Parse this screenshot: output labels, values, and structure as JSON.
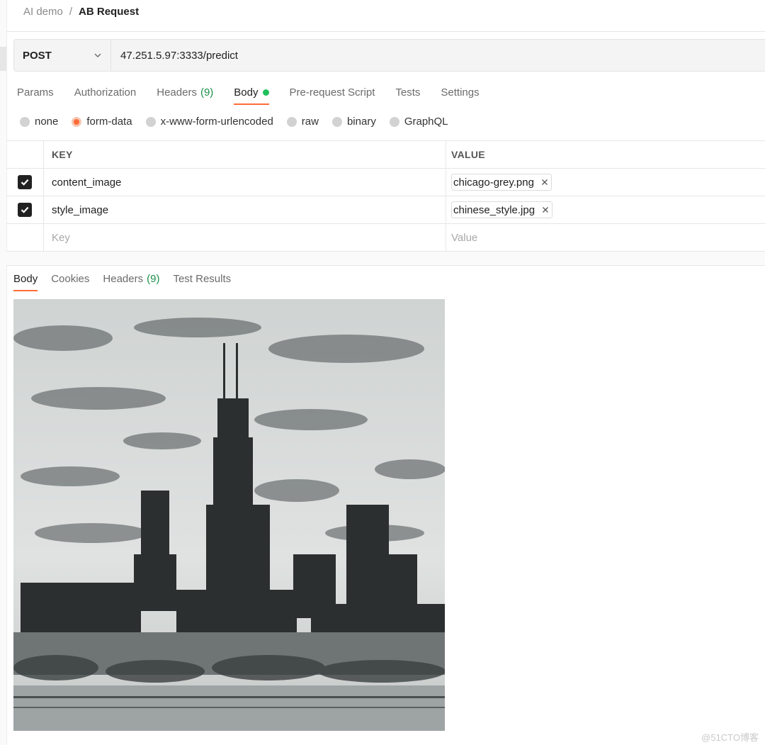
{
  "breadcrumb": {
    "parent": "AI demo",
    "separator": "/",
    "current": "AB Request"
  },
  "request": {
    "method": "POST",
    "url": "47.251.5.97:3333/predict"
  },
  "request_tabs": [
    {
      "label": "Params"
    },
    {
      "label": "Authorization"
    },
    {
      "label": "Headers",
      "count": "(9)"
    },
    {
      "label": "Body",
      "active": true
    },
    {
      "label": "Pre-request Script"
    },
    {
      "label": "Tests"
    },
    {
      "label": "Settings"
    }
  ],
  "body_types": [
    {
      "label": "none"
    },
    {
      "label": "form-data",
      "selected": true
    },
    {
      "label": "x-www-form-urlencoded"
    },
    {
      "label": "raw"
    },
    {
      "label": "binary"
    },
    {
      "label": "GraphQL"
    }
  ],
  "form_table": {
    "headers": {
      "key": "KEY",
      "value": "VALUE"
    },
    "rows": [
      {
        "checked": true,
        "key": "content_image",
        "value": "chicago-grey.png"
      },
      {
        "checked": true,
        "key": "style_image",
        "value": "chinese_style.jpg"
      }
    ],
    "placeholder": {
      "key": "Key",
      "value": "Value"
    }
  },
  "response_tabs": [
    {
      "label": "Body",
      "active": true
    },
    {
      "label": "Cookies"
    },
    {
      "label": "Headers",
      "count": "(9)"
    },
    {
      "label": "Test Results"
    }
  ],
  "colors": {
    "accent": "#ff6c37",
    "success": "#1fbf5c",
    "count_text": "#1a8f4a"
  },
  "watermark": "@51CTO博客"
}
